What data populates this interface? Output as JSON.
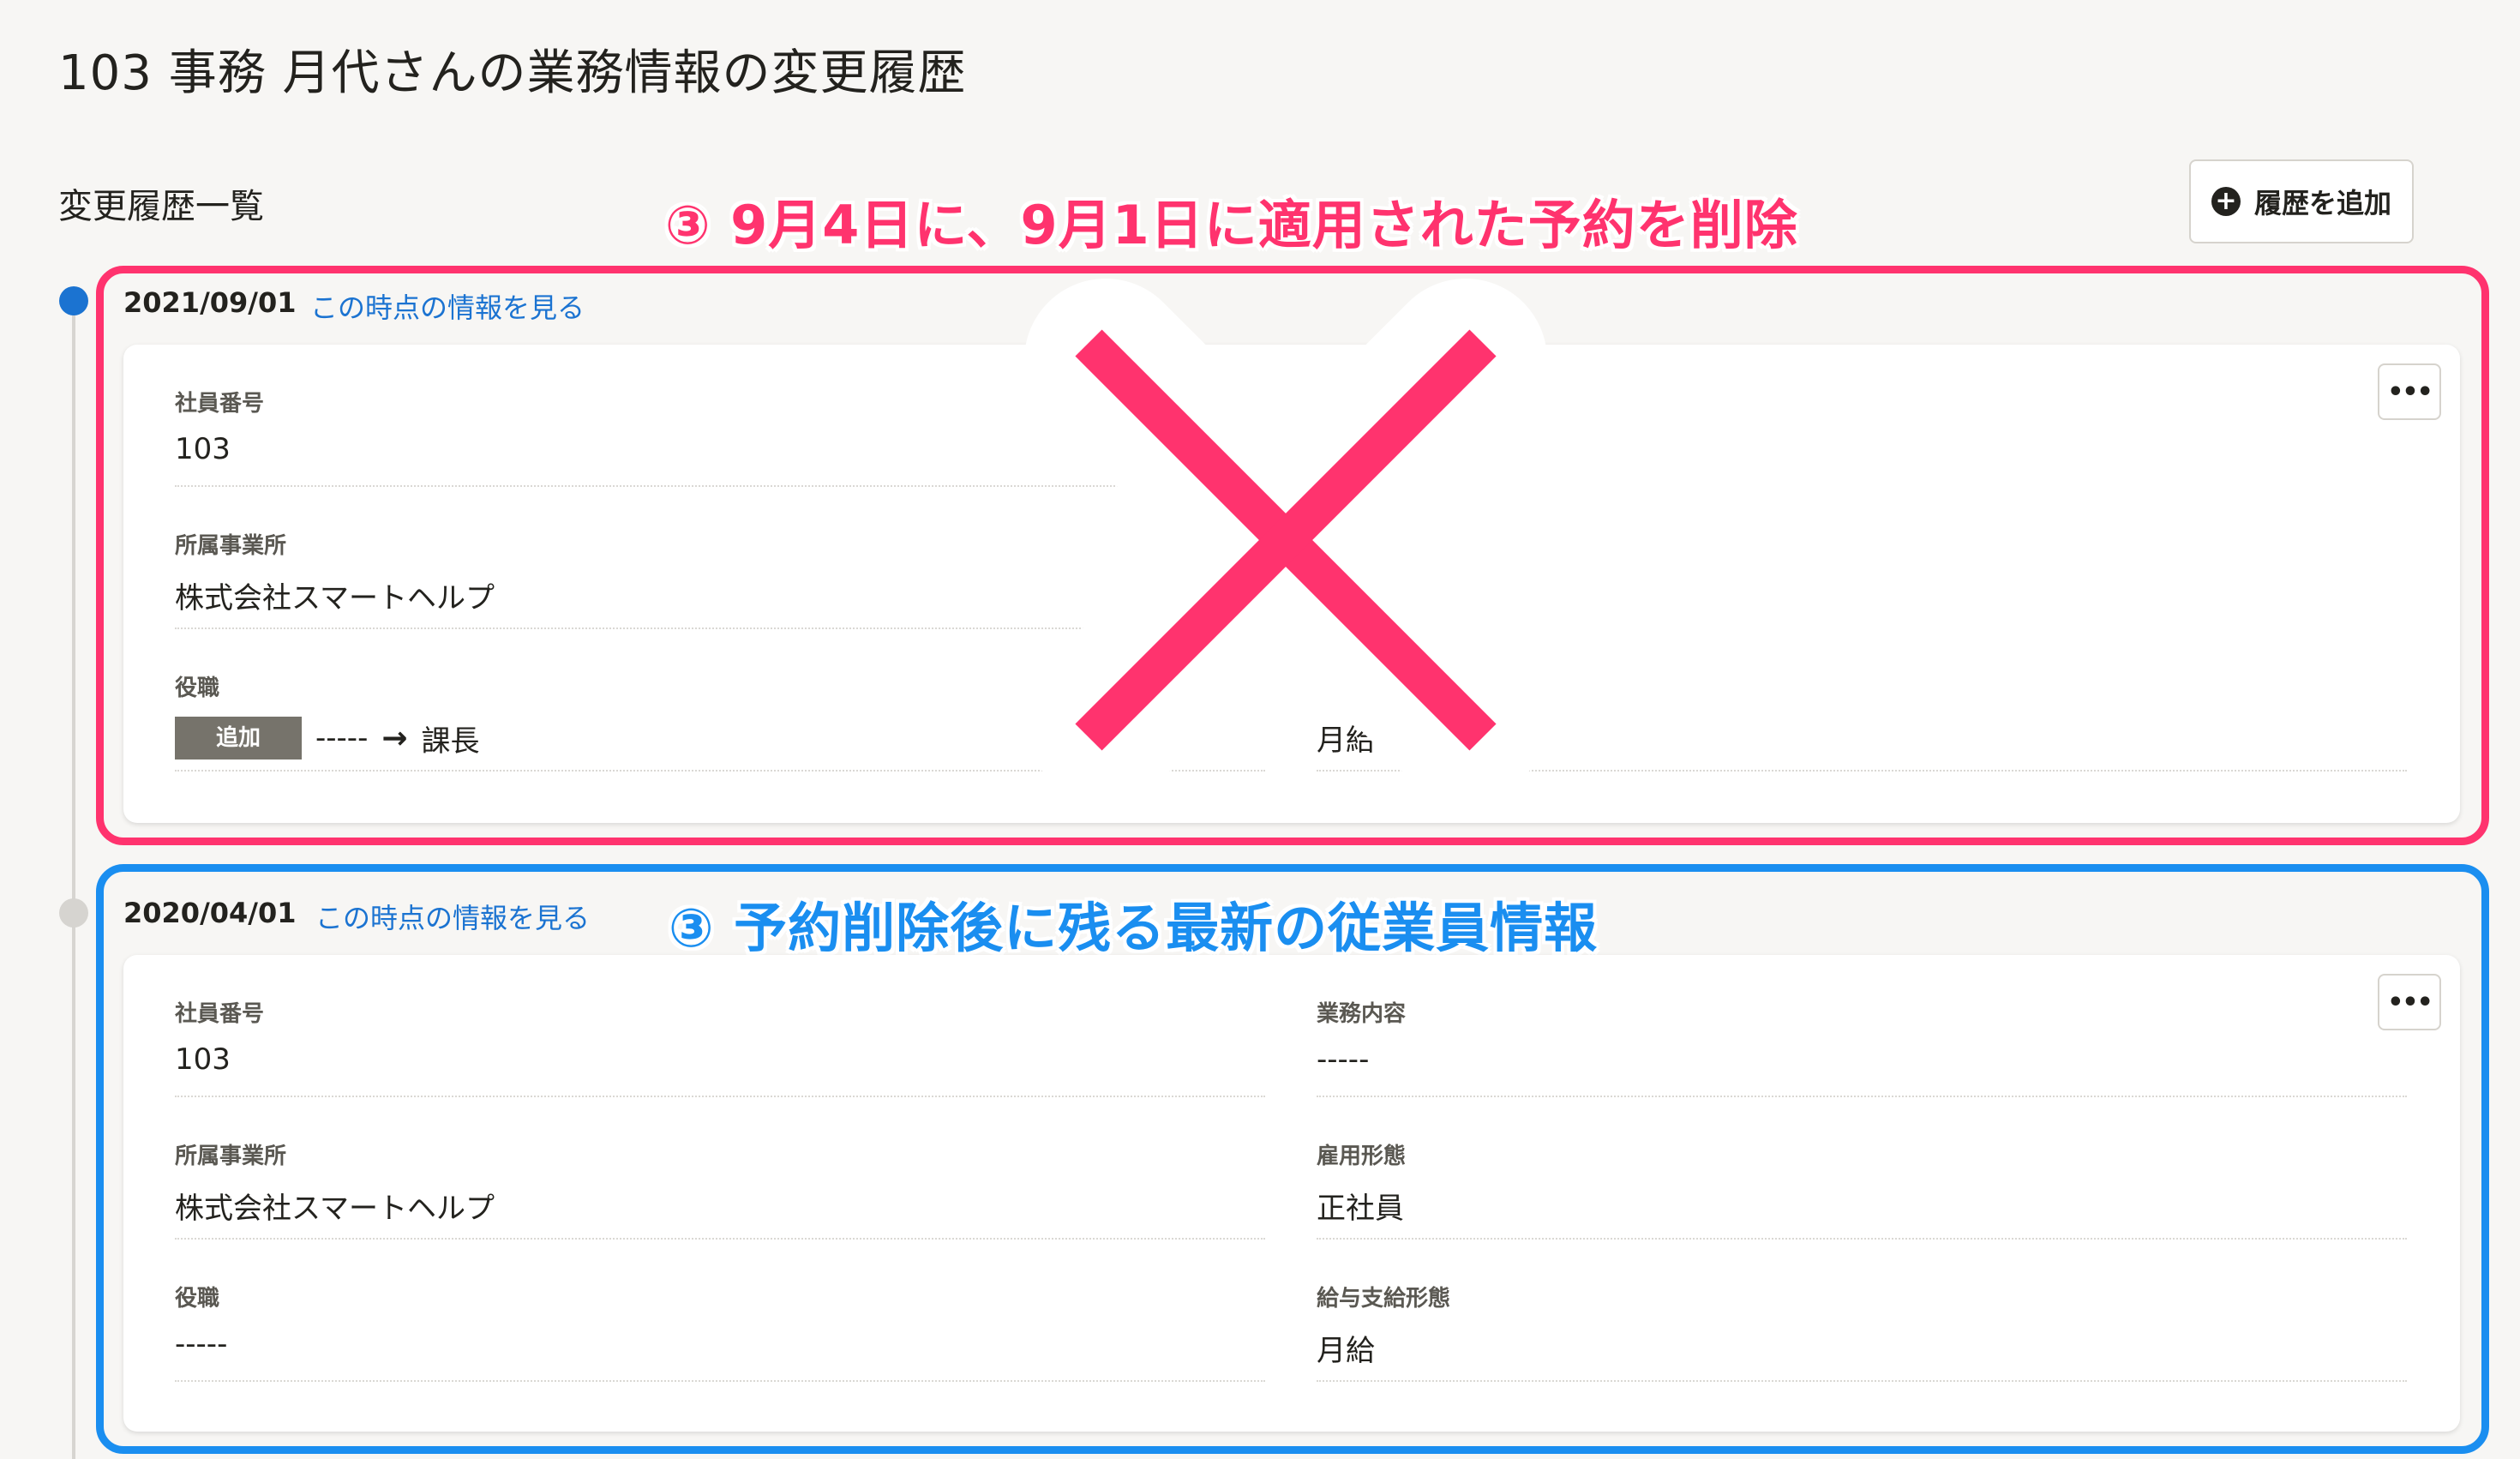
{
  "page": {
    "title": "103 事務 月代さんの業務情報の変更履歴",
    "section_title": "変更履歴一覧",
    "add_button_label": "履歴を追加"
  },
  "annotations": {
    "red_callout": "③ 9月4日に、9月1日に適用された予約を削除",
    "blue_callout": "③ 予約削除後に残る最新の従業員情報"
  },
  "history": [
    {
      "date": "2021/09/01",
      "link": "この時点の情報を見る",
      "menu_label": "•••",
      "fields": {
        "employee_no": {
          "label": "社員番号",
          "value": "103"
        },
        "office": {
          "label": "所属事業所",
          "value": "株式会社スマートヘルプ"
        },
        "position": {
          "label": "役職",
          "badge": "追加",
          "old": "-----",
          "new": "課長"
        },
        "pay_type": {
          "value": "月給"
        }
      }
    },
    {
      "date": "2020/04/01",
      "link": "この時点の情報を見る",
      "menu_label": "•••",
      "fields": {
        "employee_no": {
          "label": "社員番号",
          "value": "103"
        },
        "job": {
          "label": "業務内容",
          "value": "-----"
        },
        "office": {
          "label": "所属事業所",
          "value": "株式会社スマートヘルプ"
        },
        "employment": {
          "label": "雇用形態",
          "value": "正社員"
        },
        "position": {
          "label": "役職",
          "value": "-----"
        },
        "pay_type": {
          "label": "給与支給形態",
          "value": "月給"
        }
      }
    }
  ],
  "colors": {
    "red": "#ff336e",
    "blue": "#1a8ef0",
    "link": "#1b73d1",
    "badge": "#76736b"
  },
  "icons": [
    "plus-circle-icon",
    "more-menu-icon",
    "arrow-right-icon",
    "cross-mark-icon"
  ]
}
